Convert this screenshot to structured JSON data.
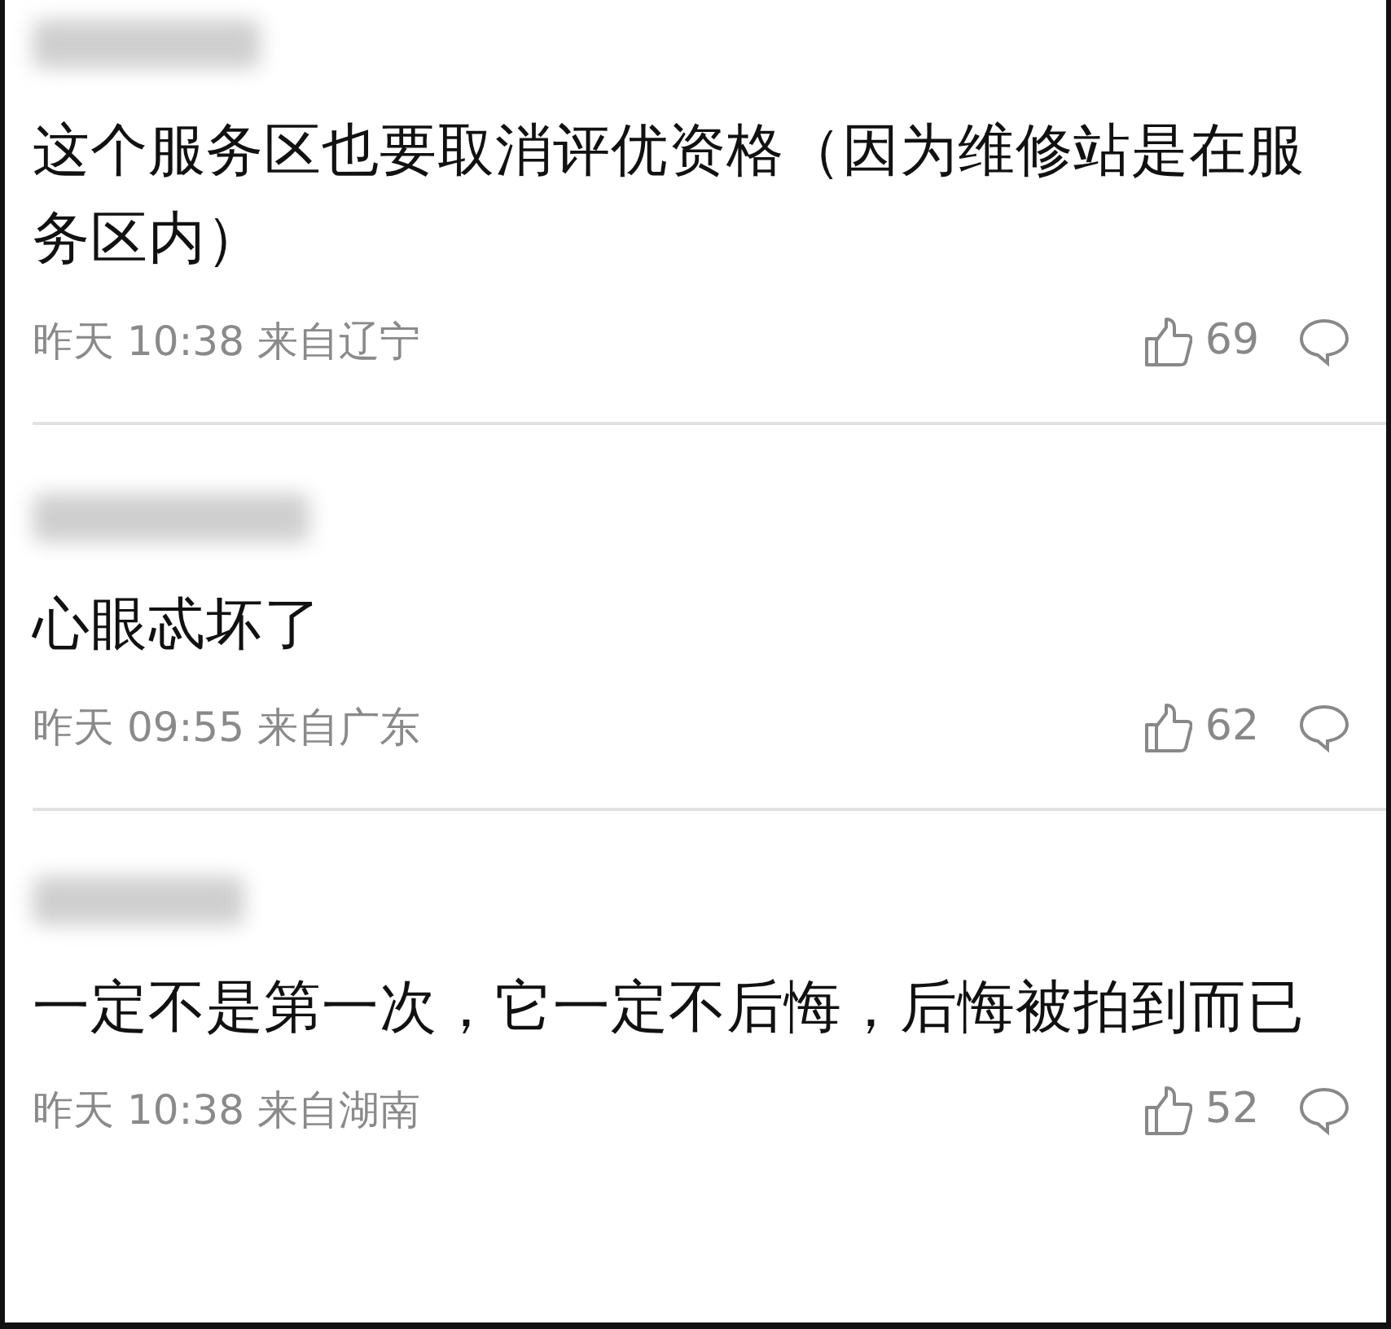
{
  "comments": [
    {
      "text": "这个服务区也要取消评优资格（因为维修站是在服务区内）",
      "time": "昨天 10:38 来自辽宁",
      "likes": "69"
    },
    {
      "text": "心眼忒坏了",
      "time": "昨天 09:55 来自广东",
      "likes": "62"
    },
    {
      "text": "一定不是第一次，它一定不后悔，后悔被拍到而已",
      "time": "昨天 10:38 来自湖南",
      "likes": "52"
    }
  ]
}
